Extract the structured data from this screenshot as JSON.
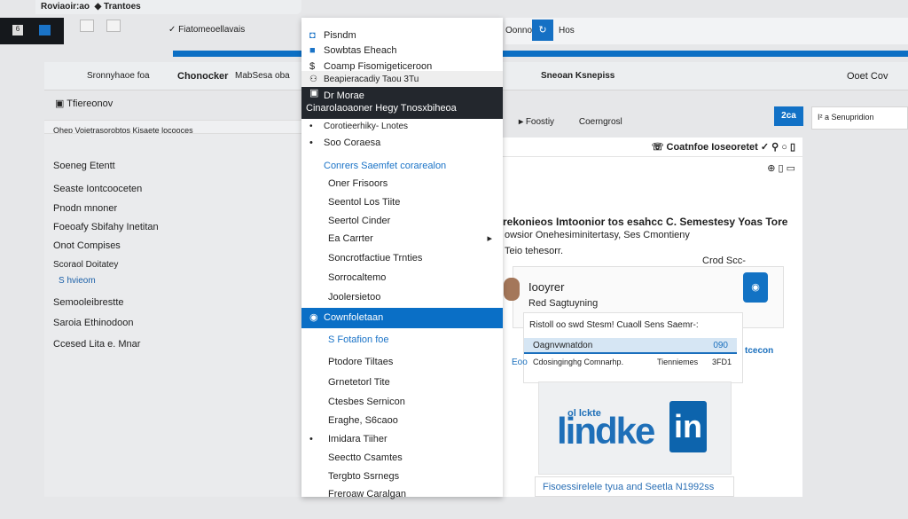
{
  "top": {
    "tab": "Roviaoir:ao",
    "tab2": "Trantoes",
    "url": "Fiatomeoellavais",
    "b1": "Oonno",
    "b2": "Hos"
  },
  "toolbar": {
    "a": "Sronnyhaoe foa",
    "b": "Chonocker",
    "c": "MabSesa oba",
    "d": "Sneoan Ksnepiss",
    "e": "Ooet Cov"
  },
  "left": {
    "title": "Tfiereonov",
    "subtitle": "Ohep Voietrasorobtos  Kisaete locooces",
    "items": [
      "Soeneg Etentt",
      "Seaste Iontcooceten",
      "Pnodn mnoner",
      "Foeoafy Sbifahy Inetitan",
      "Onot Compises",
      "Scoraol Doitatey",
      "S hvieom",
      "Semooleibrestte",
      "Saroia Ethinodoon",
      "Ccesed Lita e. Mnar"
    ]
  },
  "menu": {
    "items": [
      "Pisndm",
      "Sowbtas Eheach",
      "Coamp Fisomigeticeroon",
      "Beapieracadiy  Taou  3Tu"
    ],
    "dark1": "Dr Morae",
    "dark2": "Cinarolaoaoner Hegy  Tnosxbiheoa",
    "items2": [
      "Corotieerhiky-  Lnotes",
      "Soo Coraesa"
    ],
    "heading": "Conrers Saemfet corarealon",
    "items3": [
      "Oner Frisoors",
      "Seentol Los Tiite",
      "Seertol Cinder",
      "Ea Carrter",
      "Soncrotfactiue Trnties",
      "Sorrocaltemo",
      "Joolersietoo"
    ],
    "selected": "Cownfoletaan",
    "blue": "S Fotafion foe",
    "items4": [
      "Ptodore Tiltaes",
      "Grnetetorl Tite",
      "Ctesbes Sernicon",
      "Eraghe, S6caoo",
      "Imidara Tiiher",
      "Seectto Csamtes",
      "Tergbto Ssrnegs",
      "Freroaw Caralgan"
    ]
  },
  "right": {
    "tabs": [
      "Foostiy",
      "Coerngrosl"
    ],
    "btn": "2ca",
    "search": "I² a Senupridion",
    "header": "Coatnfoe  Ioseoretet",
    "headline": "rekonieos Imtoonior tos esahcc C. Semestesy Yoas Tore",
    "line2": "owsior Onehesiminitertasy, Ses Cmontieny",
    "line3": "Teio tehesorr.",
    "cta": "Crod Scc-",
    "name": "Iooyrer",
    "role": "Red Sagtuyning",
    "question": "Ristoll oo swd Stesm! Cuaoll Sens Saemr-:",
    "field": "Oagnvwnatdon",
    "fieldval": "090",
    "meta1": "Eoo",
    "meta2": "Cdosinginghg Comnarhp.",
    "meta3": "Tienniemes",
    "meta4": "3FD1",
    "side": "tcecon",
    "logo_small": "ol lckte",
    "logo_word": "lindke",
    "logo_in": "in",
    "bottom": "Fisoessirelele tyua and Seetla N1992ss"
  },
  "colors": {
    "accent": "#0c6fc4",
    "dark": "#23272d"
  }
}
